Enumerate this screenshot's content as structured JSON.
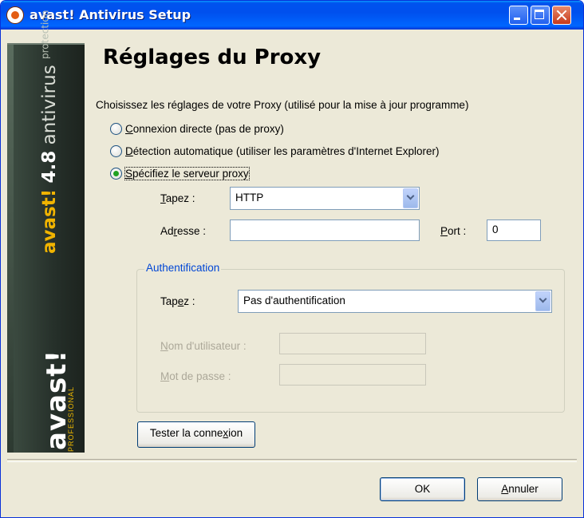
{
  "window": {
    "title": "avast! Antivirus Setup"
  },
  "sidebar": {
    "brand_name": "avast!",
    "version": "4.8",
    "product": "antivirus",
    "tagline": "protection",
    "logo": "avast!",
    "edition": "PROFESSIONAL"
  },
  "page": {
    "heading": "Réglages du Proxy",
    "description": "Choisissez les réglages de votre Proxy (utilisé pour la mise à jour programme)"
  },
  "options": [
    {
      "label_pre": "",
      "accesskey": "C",
      "label_post": "onnexion directe (pas de proxy)",
      "checked": false
    },
    {
      "label_pre": "",
      "accesskey": "D",
      "label_post": "étection automatique (utiliser les paramètres d'Internet Explorer)",
      "checked": false
    },
    {
      "label_pre": "",
      "accesskey": "S",
      "label_post": "pécifiez le serveur proxy",
      "checked": true
    }
  ],
  "proxy": {
    "type_label_pre": "",
    "type_label_key": "T",
    "type_label_post": "apez :",
    "type_value": "HTTP",
    "address_label_pre": "Ad",
    "address_label_key": "r",
    "address_label_post": "esse :",
    "address_value": "",
    "port_label_pre": "",
    "port_label_key": "P",
    "port_label_post": "ort :",
    "port_value": "0"
  },
  "auth": {
    "group_title": "Authentification",
    "type_label_pre": "Tap",
    "type_label_key": "e",
    "type_label_post": "z :",
    "type_value": "Pas d'authentification",
    "username_label_pre": "",
    "username_label_key": "N",
    "username_label_post": "om d'utilisateur :",
    "username_value": "",
    "password_label_pre": "",
    "password_label_key": "M",
    "password_label_post": "ot de passe :",
    "password_value": ""
  },
  "buttons": {
    "test_pre": "Tester la conne",
    "test_key": "x",
    "test_post": "ion",
    "ok": "OK",
    "cancel_pre": "",
    "cancel_key": "A",
    "cancel_post": "nnuler"
  },
  "colors": {
    "accent_yellow": "#f1b400",
    "group_title_blue": "#0046d5",
    "titlebar_blue": "#0053ee"
  }
}
